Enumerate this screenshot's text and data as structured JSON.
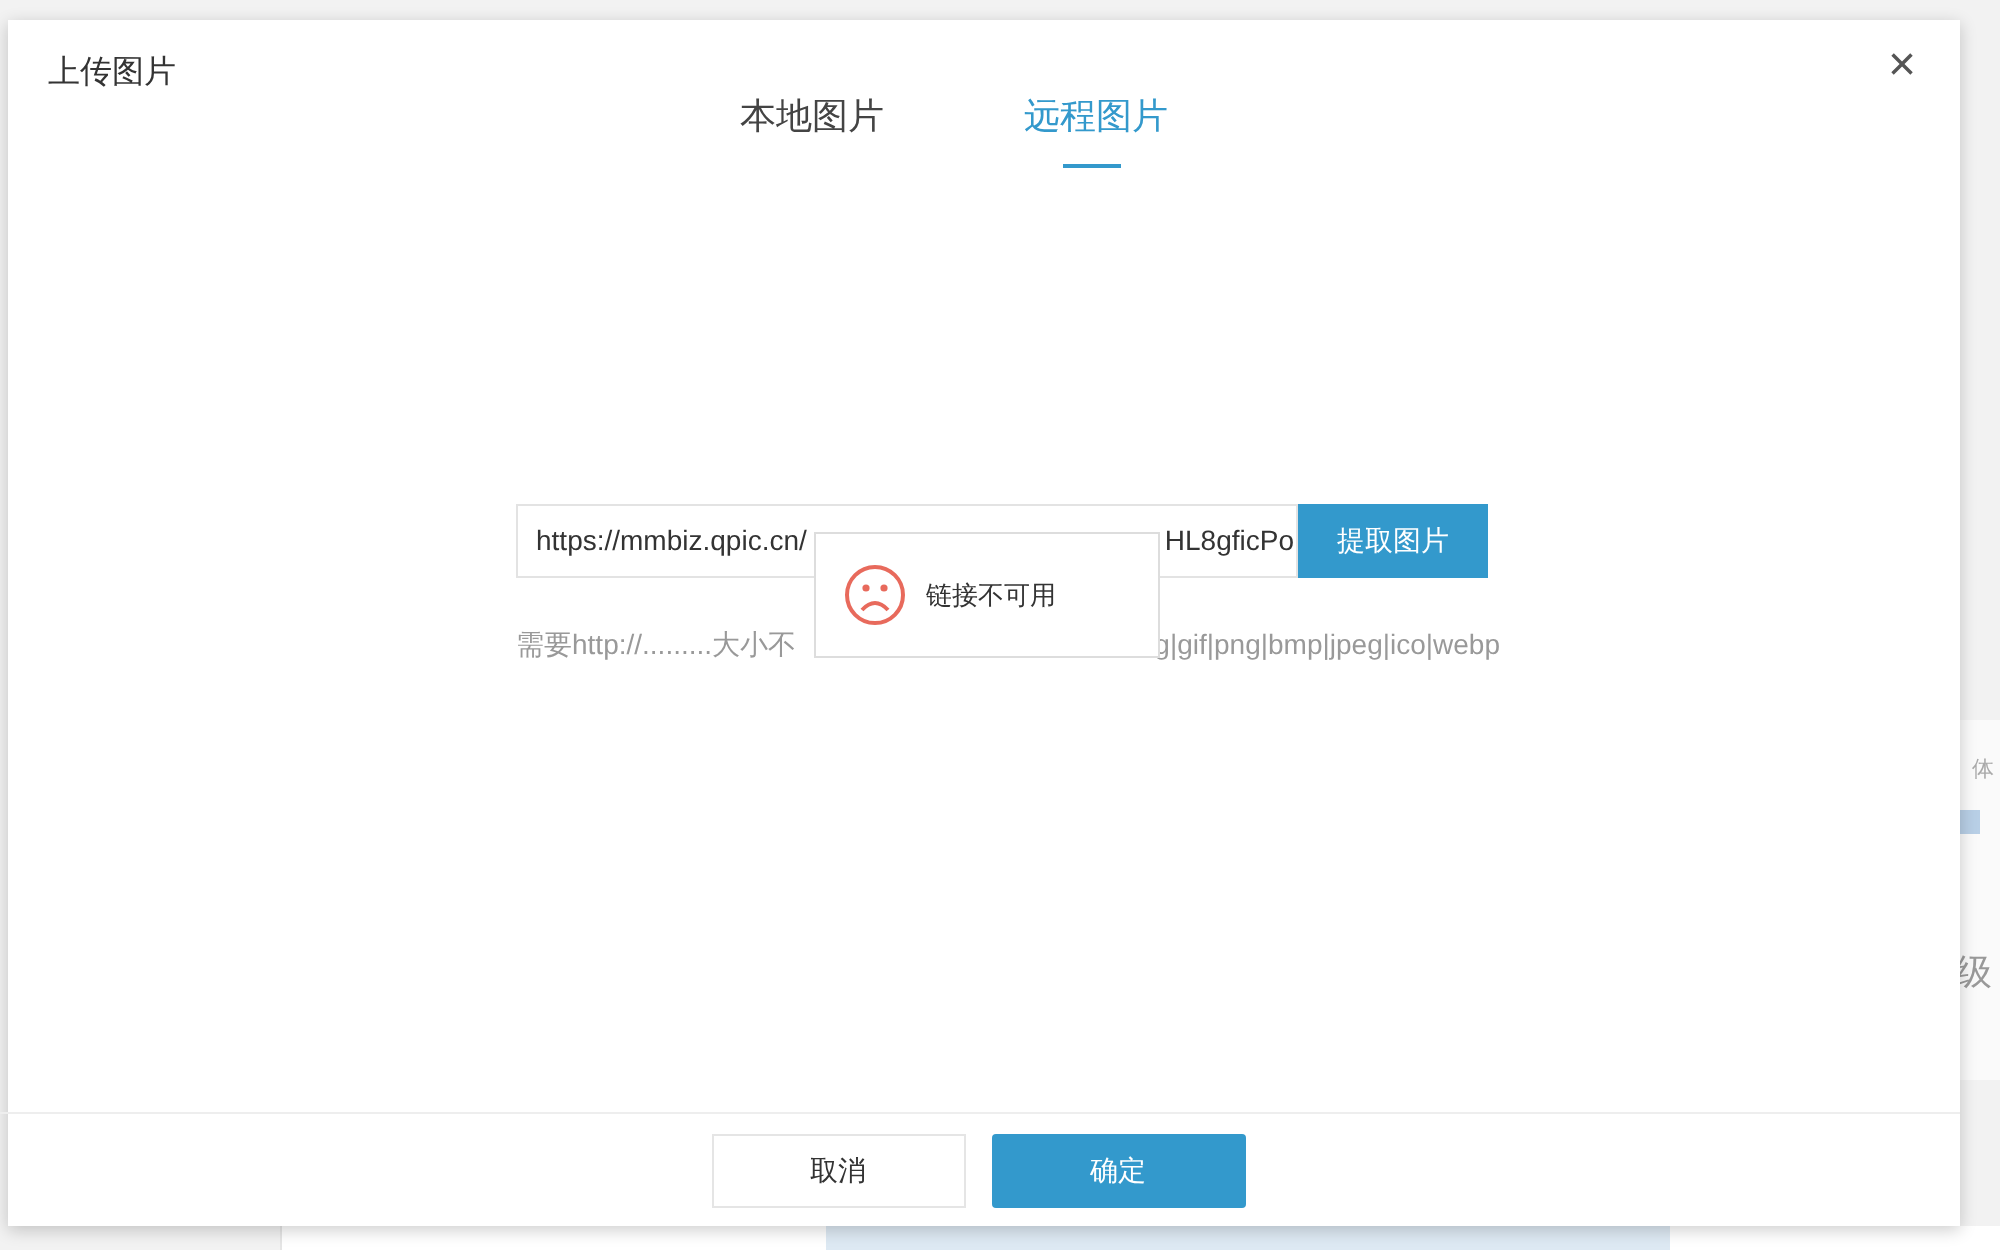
{
  "background": {
    "texts": [
      "体",
      "级"
    ]
  },
  "dialog": {
    "title": "上传图片",
    "close": "×",
    "tabs": [
      {
        "label": "本地图片",
        "selected": false
      },
      {
        "label": "远程图片",
        "selected": true
      }
    ],
    "url_field": {
      "value_start": "https://mmbiz.qpic.cn/",
      "value_end": "HL8gficPo"
    },
    "fetch_button": "提取图片",
    "hint_start": "需要http://.........大小不",
    "hint_end": "g|gif|png|bmp|jpeg|ico|webp",
    "toast": {
      "message": "链接不可用"
    },
    "buttons": [
      {
        "label": "取消",
        "kind": "secondary"
      },
      {
        "label": "确定",
        "kind": "primary"
      }
    ]
  }
}
